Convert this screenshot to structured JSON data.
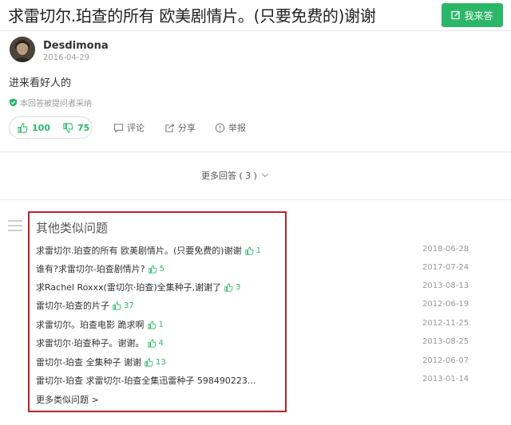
{
  "question": {
    "title": "求雷切尔.珀查的所有 欧美剧情片。(只要免费的)谢谢",
    "answer_button": "我来答"
  },
  "answer": {
    "author": "Desdimona",
    "date": "2016-04-29",
    "text": "进来看好人的",
    "adopted_note": "本回答被提问者采纳",
    "likes": "100",
    "dislikes": "75",
    "actions": {
      "comment": "评论",
      "share": "分享",
      "report": "举报"
    }
  },
  "more_answers": "更多回答 ( 3 )",
  "similar": {
    "title": "其他类似问题",
    "items": [
      {
        "text": "求雷切尔.珀查的所有 欧美剧情片。(只要免费的)谢谢",
        "likes": "1",
        "date": "2018-06-28"
      },
      {
        "text": "谁有?求雷切尔-珀查剧情片?",
        "likes": "5",
        "date": "2017-07-24"
      },
      {
        "text": "求Rachel Roxxx(雷切尔·珀查)全集种子,谢谢了",
        "likes": "3",
        "date": "2013-08-13"
      },
      {
        "text": "雷切尔-珀查的片子",
        "likes": "37",
        "date": "2012-06-19"
      },
      {
        "text": "求雷切尔。珀查电影 跪求啊",
        "likes": "1",
        "date": "2012-11-25"
      },
      {
        "text": "求雷切尔·珀查种子。谢谢。",
        "likes": "4",
        "date": "2013-08-25"
      },
      {
        "text": "雷切尔-珀查 全集种子 谢谢",
        "likes": "13",
        "date": "2012-06-07"
      },
      {
        "text": "雷切尔-珀查 求雷切尔-珀查全集迅雷种子 598490223...",
        "likes": "",
        "date": "2013-01-14"
      }
    ],
    "more_link": "更多类似问题 >"
  },
  "colors": {
    "accent_green": "#2bb768",
    "highlight_red": "#c22228"
  }
}
